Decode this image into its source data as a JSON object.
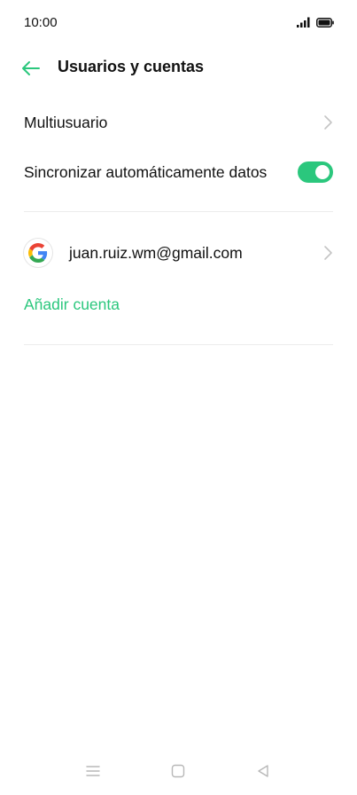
{
  "status_bar": {
    "time": "10:00",
    "icons": [
      "signal-icon",
      "battery-icon"
    ]
  },
  "header": {
    "back_icon": "arrow-left-icon",
    "title": "Usuarios y cuentas"
  },
  "settings": {
    "multiuser_label": "Multiusuario",
    "auto_sync_label": "Sincronizar automáticamente datos",
    "auto_sync_enabled": true
  },
  "accounts": {
    "items": [
      {
        "email": "juan.ruiz.wm@gmail.com",
        "provider_icon": "google-icon"
      }
    ],
    "add_label": "Añadir cuenta"
  },
  "colors": {
    "accent": "#2bc77d",
    "text": "#111111",
    "divider": "#ececec",
    "chevron": "#c4c4c4",
    "nav": "#b8b8b8"
  },
  "nav_bar": {
    "buttons": [
      "menu-icon",
      "home-icon",
      "back-triangle-icon"
    ]
  }
}
